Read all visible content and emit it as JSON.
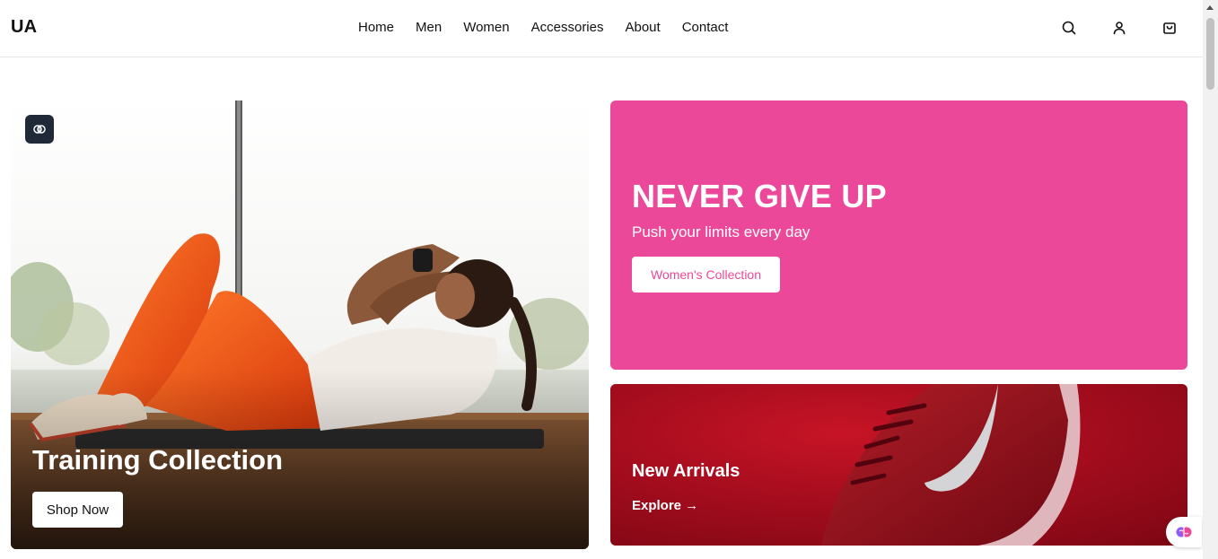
{
  "header": {
    "logo": "UA",
    "nav": [
      "Home",
      "Men",
      "Women",
      "Accessories",
      "About",
      "Contact"
    ],
    "icons": [
      "search-icon",
      "user-icon",
      "shopping-bag-icon"
    ]
  },
  "hero": {
    "title": "Training Collection",
    "button": "Shop Now"
  },
  "promo": {
    "title": "NEVER GIVE UP",
    "subtitle": "Push your limits every day",
    "button": "Women's Collection",
    "color": "#ec4899"
  },
  "arrivals": {
    "title": "New Arrivals",
    "link": "Explore →",
    "color": "#c3101f"
  }
}
